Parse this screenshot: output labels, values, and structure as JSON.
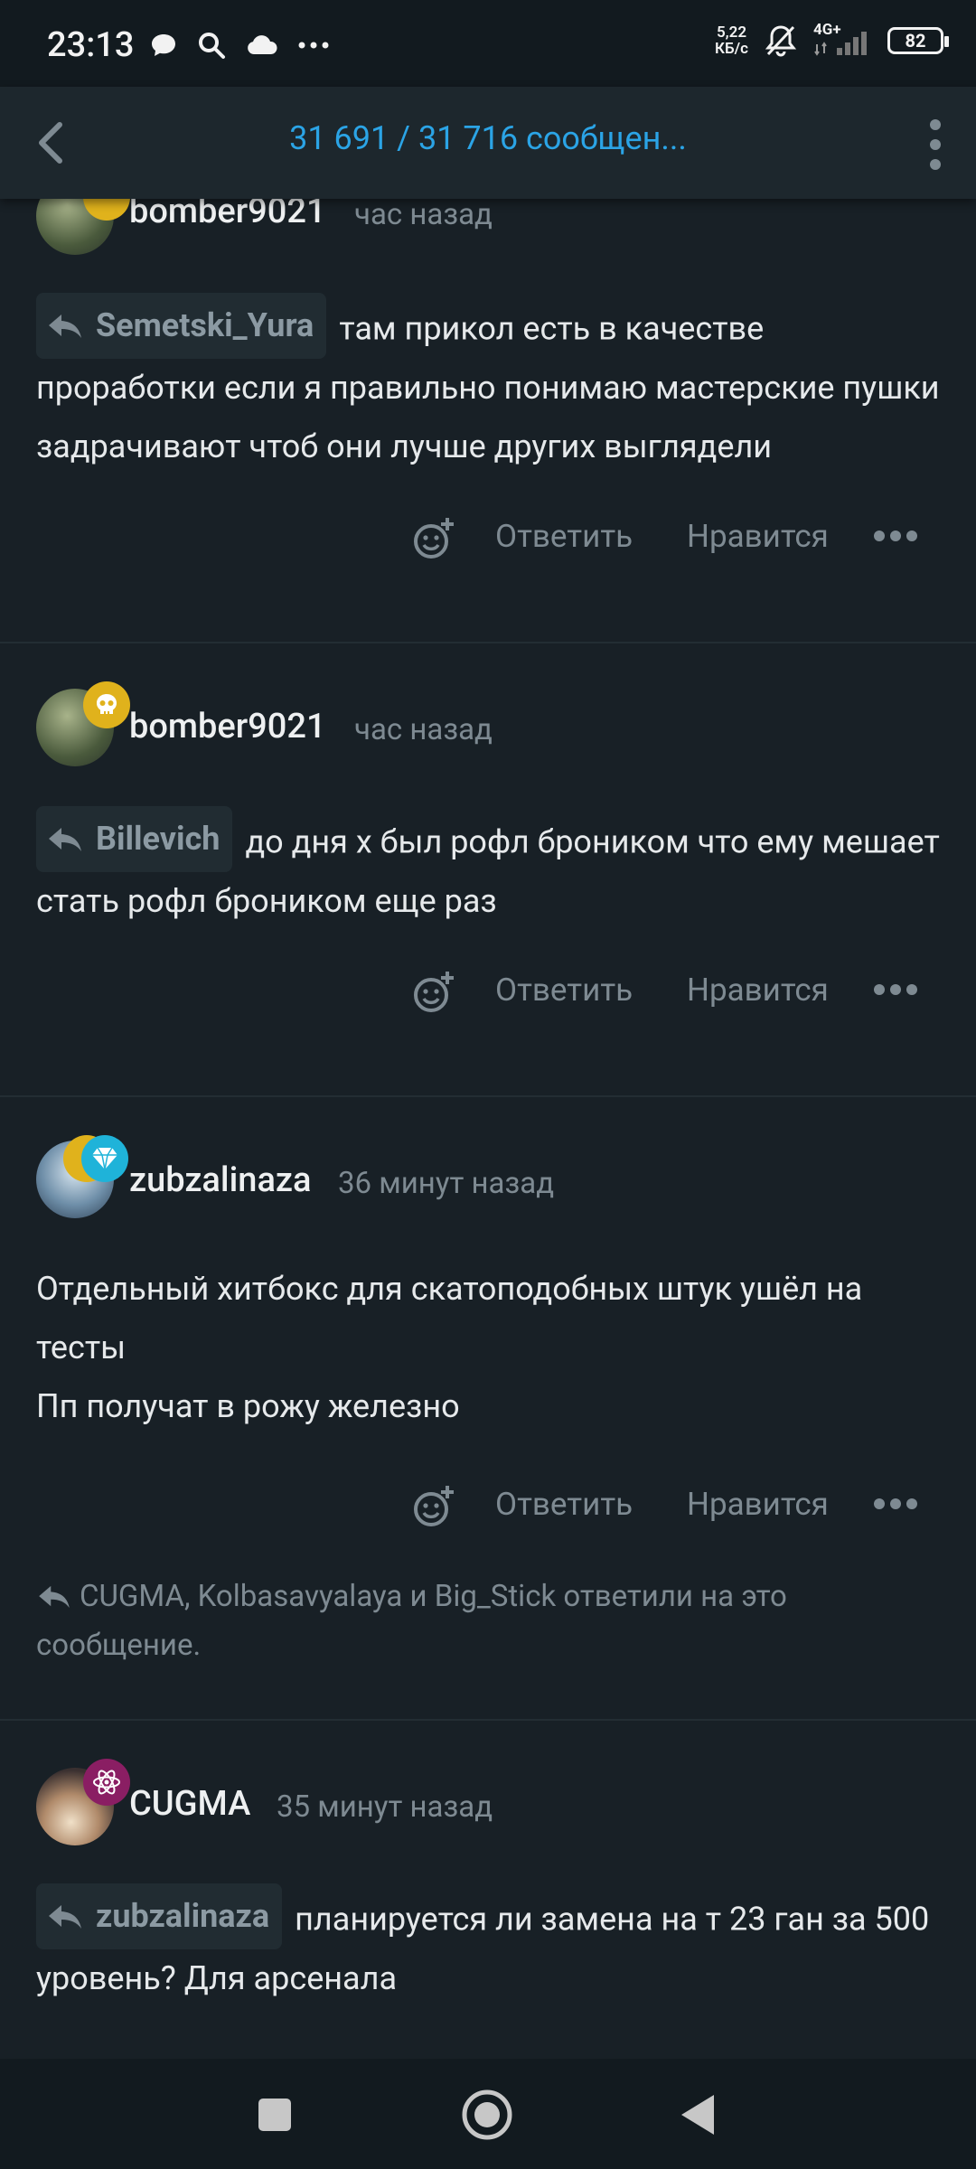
{
  "status_bar": {
    "time": "23:13",
    "speed_value": "5,22",
    "speed_unit": "КБ/с",
    "network": "4G+",
    "battery": "82"
  },
  "header": {
    "title": "31 691 / 31 716 сообщен..."
  },
  "posts": [
    {
      "username": "bomber9021",
      "time": "час назад",
      "reply_to": "Semetski_Yura",
      "text": "там прикол есть в качестве проработки если я правильно понимаю мастерские пушки задрачивают чтоб они лучше других выглядели",
      "reply_label": "Ответить",
      "like_label": "Нравится"
    },
    {
      "username": "bomber9021",
      "time": "час назад",
      "reply_to": "Billevich",
      "text": "до дня х был рофл броником что ему мешает стать рофл броником еще раз",
      "reply_label": "Ответить",
      "like_label": "Нравится"
    },
    {
      "username": "zubzalinaza",
      "time": "36 минут назад",
      "text_line1": "Отдельный хитбокс для скатоподобных штук ушёл на тесты",
      "text_line2": "Пп получат в рожу железно",
      "reply_label": "Ответить",
      "like_label": "Нравится",
      "replied_note": "CUGMA, Kolbasavyalaya и Big_Stick ответили на это сообщение."
    },
    {
      "username": "CUGMA",
      "time": "35 минут назад",
      "reply_to": "zubzalinaza",
      "text": "планируется ли замена на т 23 ган за 500 уровень? Для арсенала"
    }
  ],
  "colors": {
    "background": "#182026",
    "header_bg": "#1d272d",
    "accent": "#2ba4e6",
    "muted": "#7e8a92"
  }
}
